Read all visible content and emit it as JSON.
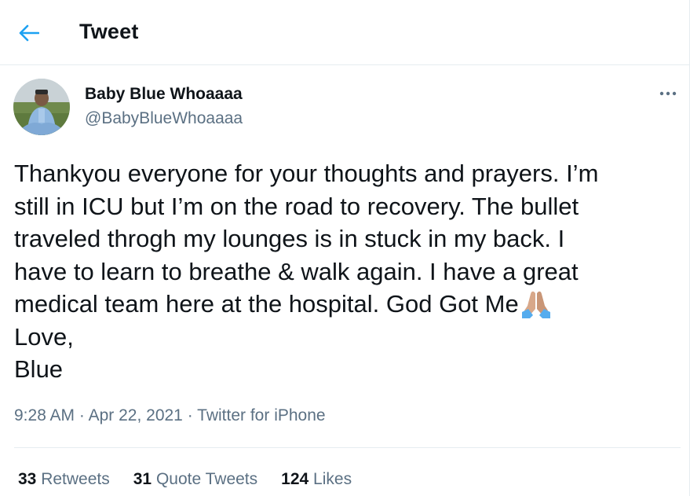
{
  "header": {
    "title": "Tweet",
    "back_icon": "arrow-left-icon",
    "accent_color": "#1da1f2"
  },
  "tweet": {
    "author": {
      "display_name": "Baby Blue Whoaaaa",
      "handle": "@BabyBlueWhoaaaa"
    },
    "more_icon": "more-horizontal-icon",
    "text_lines": [
      "Thankyou everyone for your thoughts and prayers. I’m",
      "still in ICU but I’m on the road to recovery. The bullet",
      "traveled throgh my lounges is in stuck in my back. I",
      "have to learn to breathe & walk again. I have a great",
      "medical team here at the hospital. God Got Me",
      "Love,",
      "Blue"
    ],
    "emoji": "folded-hands-emoji",
    "time": "9:28 AM",
    "date": "Apr 22, 2021",
    "source": "Twitter for iPhone",
    "separator": "·"
  },
  "stats": {
    "retweets": {
      "count": "33",
      "label": "Retweets"
    },
    "quote_tweets": {
      "count": "31",
      "label": "Quote Tweets"
    },
    "likes": {
      "count": "124",
      "label": "Likes"
    }
  }
}
